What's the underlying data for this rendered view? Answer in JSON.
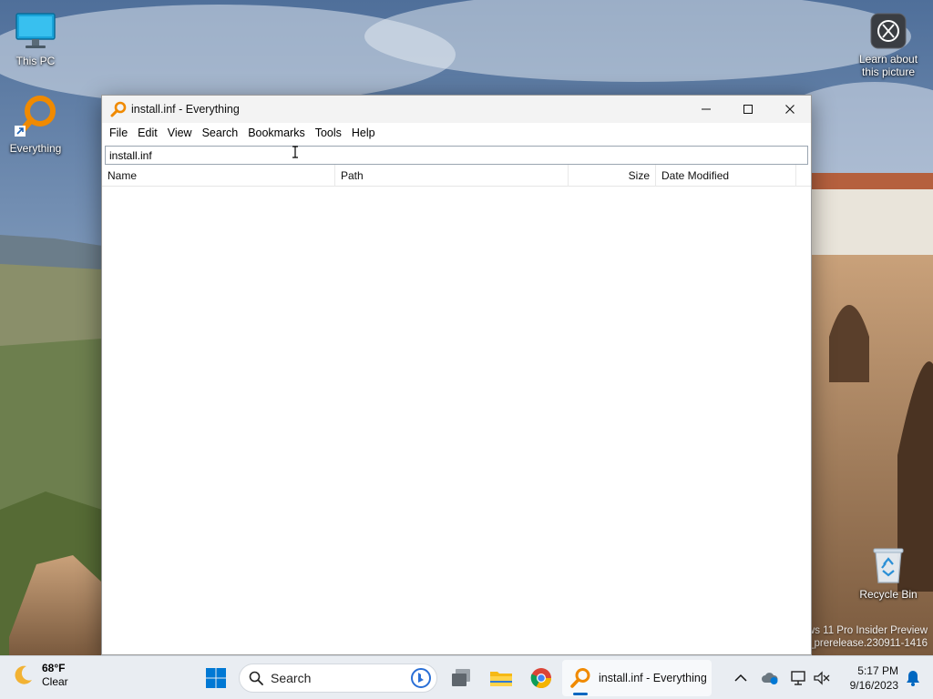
{
  "desktop": {
    "icons": [
      {
        "label": "This PC",
        "icon": "monitor-icon"
      },
      {
        "label": "Everything",
        "icon": "everything-magnifier-icon"
      },
      {
        "label": "Learn about this picture",
        "icon": "camera-info-icon"
      },
      {
        "label": "Recycle Bin",
        "icon": "recycle-bin-icon"
      }
    ],
    "watermark_line1": "ws 11 Pro Insider Preview",
    "watermark_line2": "s_prerelease.230911-1416"
  },
  "window": {
    "title": "install.inf - Everything",
    "menu": [
      "File",
      "Edit",
      "View",
      "Search",
      "Bookmarks",
      "Tools",
      "Help"
    ],
    "search_value": "install.inf",
    "columns": [
      "Name",
      "Path",
      "Size",
      "Date Modified"
    ],
    "results": []
  },
  "taskbar": {
    "weather": {
      "temp": "68°F",
      "condition": "Clear",
      "icon": "moon-icon"
    },
    "search_placeholder": "Search",
    "active_app_label": "install.inf - Everything",
    "clock": {
      "time": "5:17 PM",
      "date": "9/16/2023"
    }
  },
  "colors": {
    "accent": "#0067c0",
    "everything_orange": "#f08a00",
    "taskbar_bg": "#e9edf2"
  }
}
